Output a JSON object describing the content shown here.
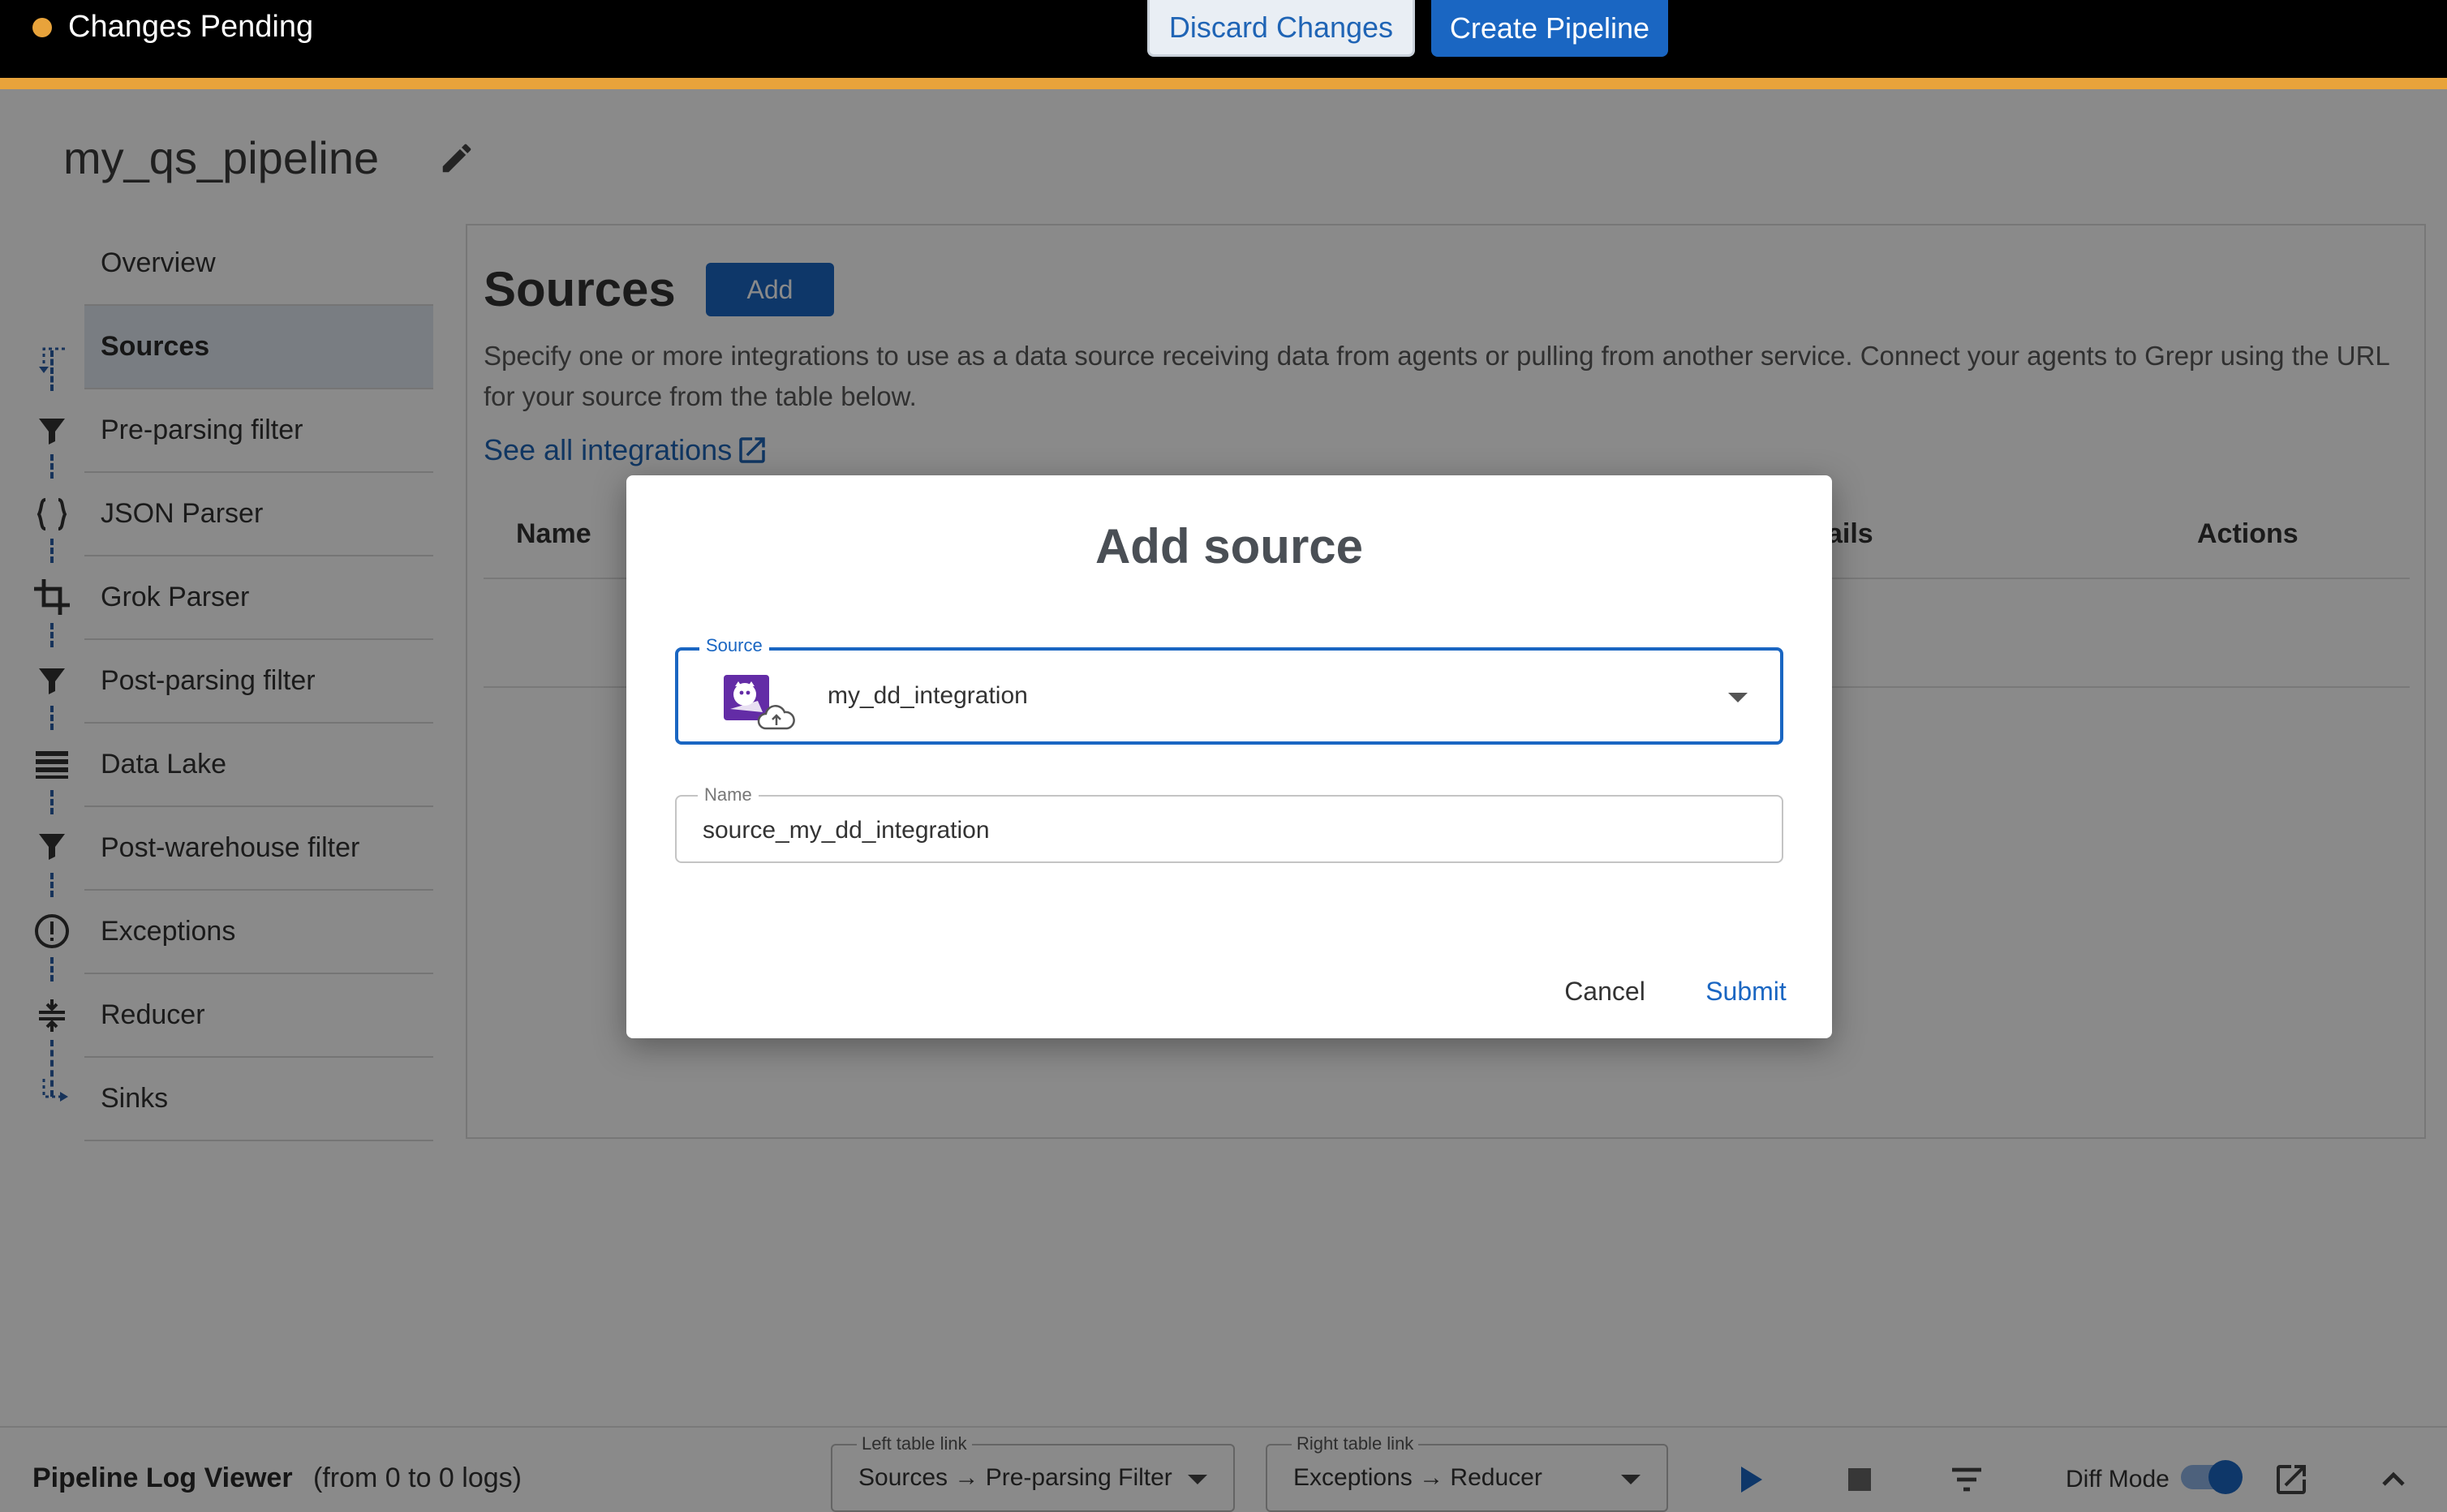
{
  "topbar": {
    "status": "Changes Pending",
    "discard_label": "Discard Changes",
    "create_label": "Create Pipeline",
    "accent_color": "#e8a33b"
  },
  "pipeline": {
    "name": "my_qs_pipeline",
    "edit_icon": "pencil-icon"
  },
  "sidebar": {
    "items": [
      {
        "label": "Overview",
        "icon": "none"
      },
      {
        "label": "Sources",
        "icon": "dashed-arrow-icon",
        "active": true
      },
      {
        "label": "Pre-parsing filter",
        "icon": "filter-icon"
      },
      {
        "label": "JSON Parser",
        "icon": "braces-icon"
      },
      {
        "label": "Grok Parser",
        "icon": "crop-icon"
      },
      {
        "label": "Post-parsing filter",
        "icon": "filter-icon"
      },
      {
        "label": "Data Lake",
        "icon": "list-icon"
      },
      {
        "label": "Post-warehouse filter",
        "icon": "filter-icon"
      },
      {
        "label": "Exceptions",
        "icon": "alert-circle-icon"
      },
      {
        "label": "Reducer",
        "icon": "compress-icon"
      },
      {
        "label": "Sinks",
        "icon": "dashed-arrow-icon"
      }
    ]
  },
  "main": {
    "title": "Sources",
    "add_label": "Add",
    "description": "Specify one or more integrations to use as a data source receiving data from agents or pulling from another service. Connect your agents to Grepr using the URL for your source from the table below.",
    "see_all_label": "See all integrations",
    "table": {
      "headers": [
        "Name",
        "ails",
        "Actions"
      ]
    }
  },
  "modal": {
    "title": "Add source",
    "source_field": {
      "label": "Source",
      "value": "my_dd_integration",
      "icon": "datadog-logo-icon"
    },
    "name_field": {
      "label": "Name",
      "value": "source_my_dd_integration"
    },
    "cancel_label": "Cancel",
    "submit_label": "Submit",
    "primary_color": "#1a66c2"
  },
  "log_viewer": {
    "title": "Pipeline Log Viewer",
    "count": "(from 0 to 0 logs)",
    "left_link": {
      "label": "Left table link",
      "value": "Sources → Pre-parsing Filter"
    },
    "right_link": {
      "label": "Right table link",
      "value": "Exceptions → Reducer"
    },
    "diff_mode_label": "Diff Mode",
    "diff_mode_on": true
  }
}
